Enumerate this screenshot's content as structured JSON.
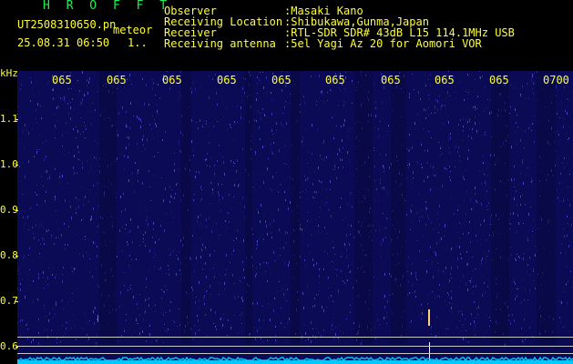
{
  "header": {
    "brand": "H R O F F T",
    "file_name": "UT2508310650.pn",
    "mode": "meteor",
    "date_time": "25.08.31 06:50",
    "count": "1.."
  },
  "station": {
    "observer_label": "Observer",
    "observer_value": ":Masaki Kano",
    "location_label": "Receiving Location",
    "location_value": ":Shibukawa,Gunma,Japan",
    "receiver_label": "Receiver",
    "receiver_value": ":RTL-SDR SDR# 43dB L15 114.1MHz USB",
    "antenna_label": "Receiving antenna",
    "antenna_value": ":5el Yagi Az 20 for Aomori VOR"
  },
  "axes": {
    "y_unit": "kHz",
    "y_ticks": [
      "1.1",
      "1.0",
      "0.9",
      "0.8",
      "0.7",
      "0.6"
    ],
    "x_ticks": [
      "065",
      "065",
      "065",
      "065",
      "065",
      "065",
      "065",
      "065",
      "065",
      "0700"
    ]
  },
  "colors": {
    "background": "#0b0b55",
    "label": "#ffff33",
    "brand": "#22ee55",
    "trace": "#00c8ff"
  }
}
